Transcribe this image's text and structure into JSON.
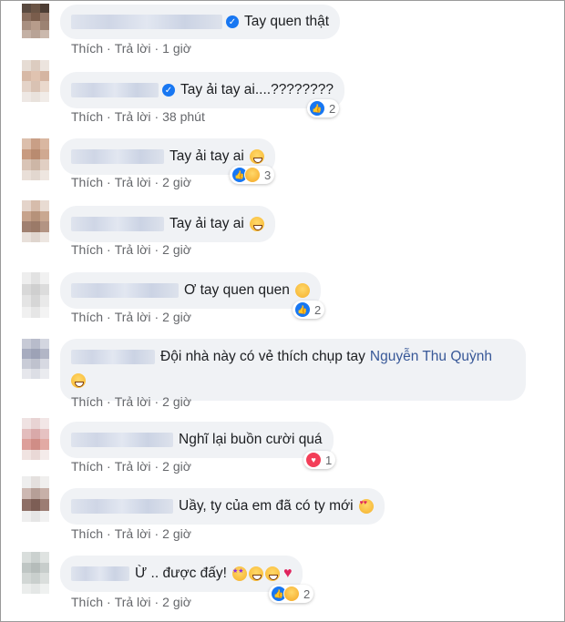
{
  "actions": {
    "like": "Thích",
    "reply": "Trả lời",
    "sep": "·"
  },
  "comments": [
    {
      "text": "Tay quen thật",
      "time": "1 giờ",
      "verified": true,
      "reactions": null
    },
    {
      "text": "Tay ải tay ai....????????",
      "time": "38 phút",
      "verified": true,
      "reactions": {
        "count": "2",
        "types": [
          "like"
        ]
      }
    },
    {
      "text": "Tay ải tay ai",
      "time": "2 giờ",
      "verified": false,
      "emoji": [
        "laugh"
      ],
      "reactions": {
        "count": "3",
        "types": [
          "like",
          "haha"
        ]
      }
    },
    {
      "text": "Tay ải tay ai",
      "time": "2 giờ",
      "verified": false,
      "emoji": [
        "laugh"
      ],
      "reactions": null
    },
    {
      "text": "Ơ tay quen quen",
      "time": "2 giờ",
      "verified": false,
      "emoji": [
        "think"
      ],
      "reactions": {
        "count": "2",
        "types": [
          "like"
        ]
      }
    },
    {
      "text": "Đội nhà này có vẻ thích chụp tay",
      "mention": "Nguyễn Thu Quỳnh",
      "time": "2 giờ",
      "verified": false,
      "emoji": [
        "laugh"
      ],
      "reactions": null
    },
    {
      "text": "Nghĩ lại buồn cười quá",
      "time": "2 giờ",
      "verified": false,
      "reactions": {
        "count": "1",
        "types": [
          "love"
        ]
      }
    },
    {
      "text": "Uầy, ty của em đã có ty mới",
      "time": "2 giờ",
      "verified": false,
      "emoji": [
        "heart-eyes"
      ],
      "reactions": null
    },
    {
      "text": "Ừ .. được đấy!",
      "time": "2 giờ",
      "verified": false,
      "emoji": [
        "star-struck",
        "laugh",
        "laugh",
        "heart"
      ],
      "reactions": {
        "count": "2",
        "types": [
          "like",
          "haha"
        ]
      }
    }
  ],
  "colors": {
    "bubble": "#f0f2f5",
    "meta": "#65676b",
    "mention": "#385898",
    "like": "#1877f2",
    "love": "#f33e58"
  }
}
